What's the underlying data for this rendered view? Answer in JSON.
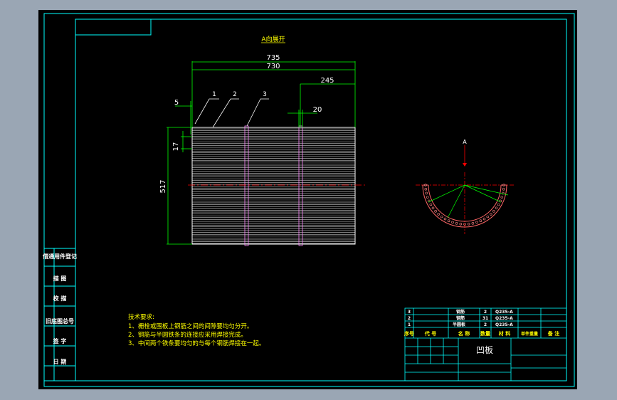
{
  "drawing": {
    "view_label": "A向展开",
    "dims": {
      "overall_1": "735",
      "overall_2": "730",
      "right_offset": "245",
      "gap_20": "20",
      "left_5": "5",
      "pitch_17": "17",
      "height_517": "517"
    },
    "balloons": [
      "1",
      "2",
      "3"
    ],
    "section_label": "A",
    "tech_title": "技术要求:",
    "tech_items": [
      "1、栅栓或围板上钢筋之间的间隙要均匀分开。",
      "2、钢筋与半圆铁条的连接应采用焊接完成。",
      "3、中间两个铁条要均匀的与每个钢筋焊接在一起。"
    ]
  },
  "side_table": {
    "rows": [
      "借通用件登记",
      "描 图",
      "校 描",
      "旧底图总号",
      "签 字",
      "日 期"
    ]
  },
  "title_block": {
    "title": "凹板",
    "parts": [
      {
        "no": "3",
        "name": "钢筋",
        "qty": "2",
        "mat": "Q235-A"
      },
      {
        "no": "2",
        "name": "钢筋",
        "qty": "31",
        "mat": "Q235-A"
      },
      {
        "no": "1",
        "name": "半圆板",
        "qty": "2",
        "mat": "Q235-A"
      }
    ],
    "header": [
      "序号",
      "代 号",
      "名 称",
      "数量",
      "材 料",
      "单件重量",
      "备 注"
    ]
  },
  "colors": {
    "frame": "#00ffff",
    "dimension": "#00ff00",
    "object": "#ffffff",
    "centerline": "#ff0000",
    "text": "#ffff00"
  }
}
